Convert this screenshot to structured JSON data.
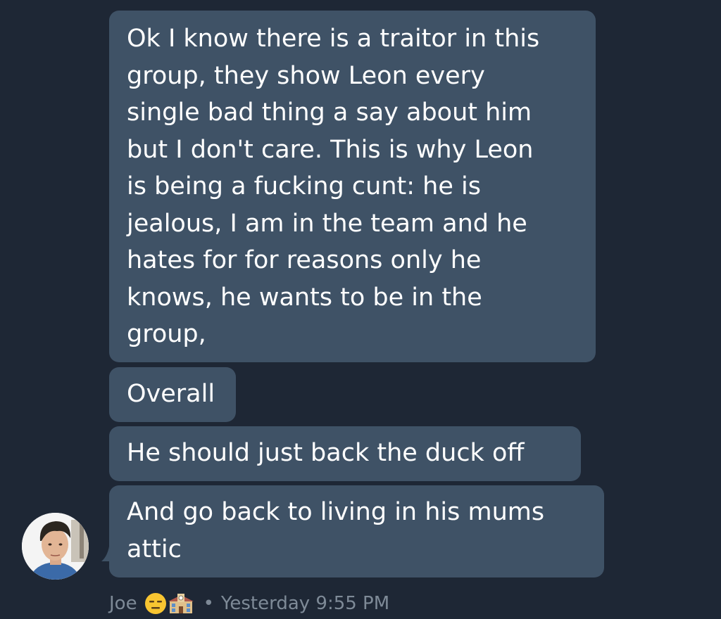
{
  "messages": [
    {
      "text": "Ok I know there is a traitor in this\ngroup, they show Leon every\nsingle bad thing a say about him\nbut I don't care. This is why Leon\nis being a fucking cunt: he is\njealous, I am in the team and he\nhates for for reasons only he\nknows, he wants to be in the\ngroup,"
    },
    {
      "text": "Overall"
    },
    {
      "text": "He should just back the duck off"
    },
    {
      "text": "And go back to living in his mums\nattic"
    }
  ],
  "sender": {
    "name": "Joe",
    "emojis": [
      "expressionless-face-emoji",
      "school-emoji"
    ],
    "separator": "•",
    "timestamp": "Yesterday 9:55 PM"
  },
  "colors": {
    "background": "#1e2735",
    "bubble": "#3f5266",
    "text": "#ffffff",
    "meta_text": "#7e8a97"
  }
}
